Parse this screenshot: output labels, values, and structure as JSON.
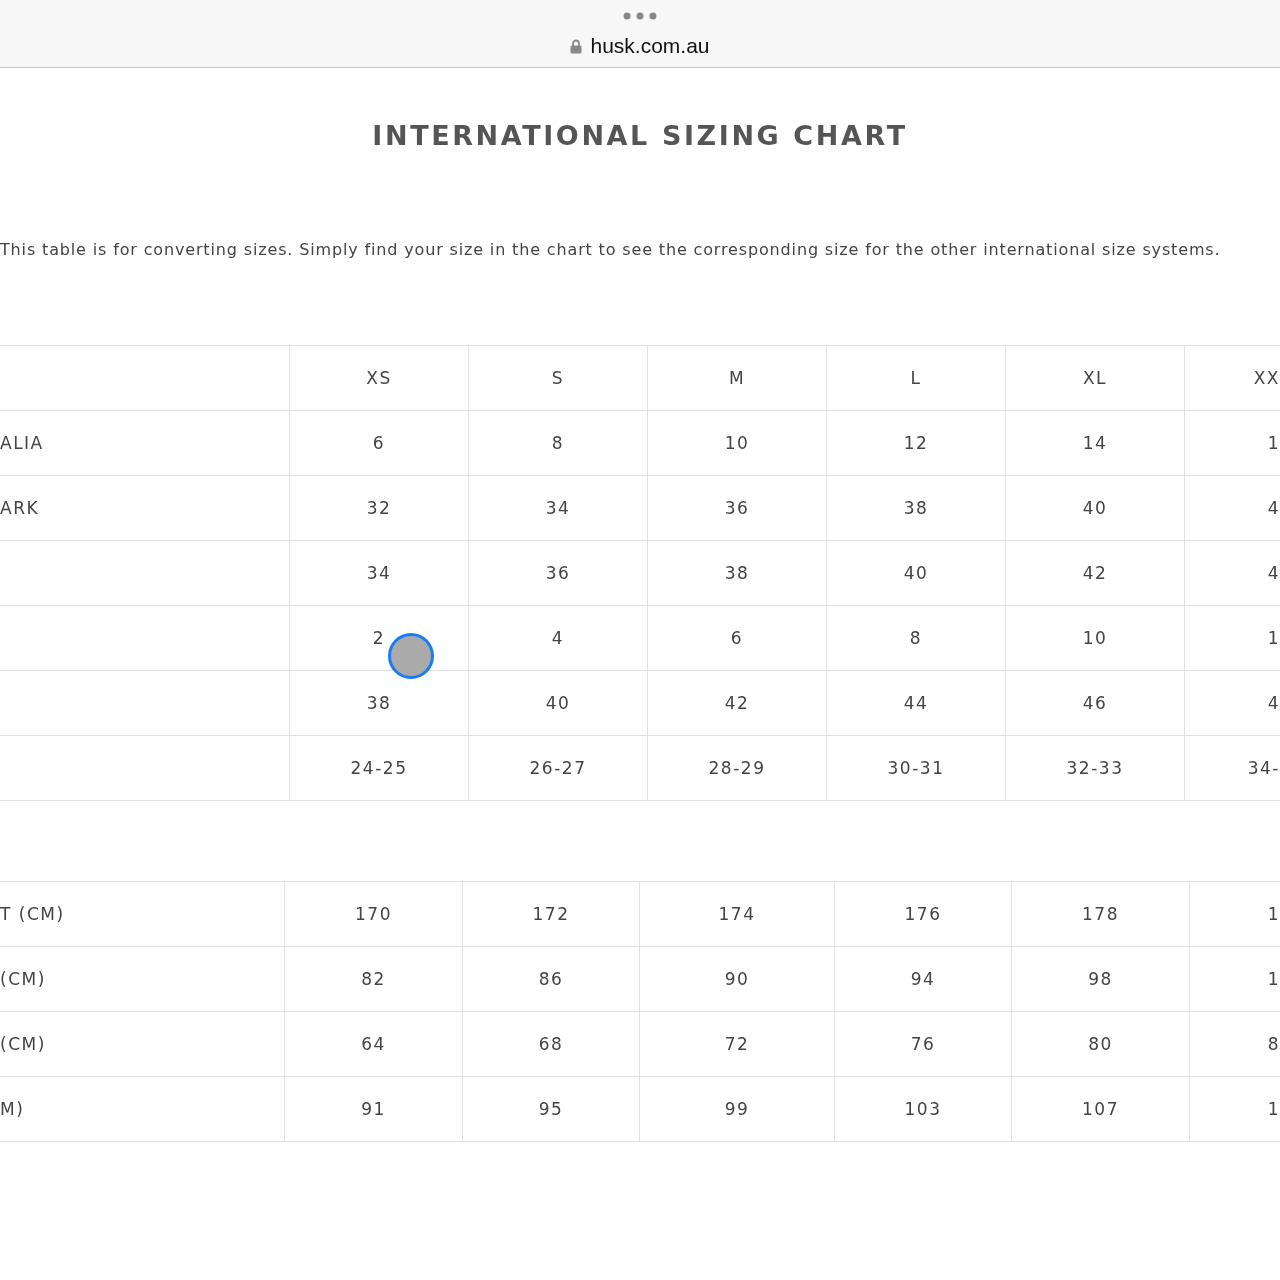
{
  "browser": {
    "url": "husk.com.au"
  },
  "title": "INTERNATIONAL SIZING CHART",
  "intro": "This table is for converting sizes. Simply find your size in the chart to see the corresponding size for the other international size systems.",
  "tables": [
    {
      "columns": [
        "XS",
        "S",
        "M",
        "L",
        "XL",
        "XX"
      ],
      "rows": [
        {
          "label": "ALIA",
          "cells": [
            "6",
            "8",
            "10",
            "12",
            "14",
            "1"
          ]
        },
        {
          "label": "ARK",
          "cells": [
            "32",
            "34",
            "36",
            "38",
            "40",
            "4"
          ]
        },
        {
          "cells": [
            "34",
            "36",
            "38",
            "40",
            "42",
            "4"
          ]
        },
        {
          "cells": [
            "2",
            "4",
            "6",
            "8",
            "10",
            "1"
          ]
        },
        {
          "cells": [
            "38",
            "40",
            "42",
            "44",
            "46",
            "4"
          ]
        },
        {
          "cells": [
            "24-25",
            "26-27",
            "28-29",
            "30-31",
            "32-33",
            "34-"
          ]
        }
      ]
    },
    {
      "rows": [
        {
          "label": "T (CM)",
          "cells": [
            "170",
            "172",
            "174",
            "176",
            "178",
            "1"
          ]
        },
        {
          "label": "(CM)",
          "cells": [
            "82",
            "86",
            "90",
            "94",
            "98",
            "1"
          ]
        },
        {
          "label": "(CM)",
          "cells": [
            "64",
            "68",
            "72",
            "76",
            "80",
            "8"
          ]
        },
        {
          "label": "M)",
          "cells": [
            "91",
            "95",
            "99",
            "103",
            "107",
            "1"
          ]
        }
      ]
    }
  ]
}
